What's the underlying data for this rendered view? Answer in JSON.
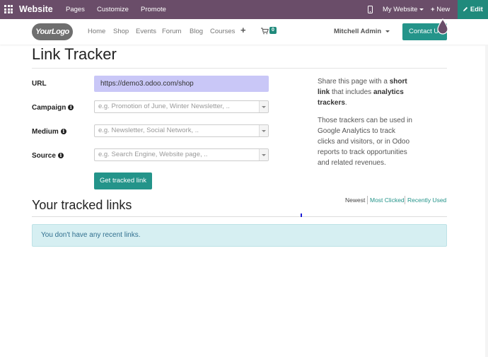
{
  "topbar": {
    "brand": "Website",
    "menu": [
      "Pages",
      "Customize",
      "Promote"
    ],
    "site_selector": "My Website",
    "new_label": "New",
    "edit_label": "Edit"
  },
  "navbar": {
    "logo_text": "YourLogo",
    "links": [
      "Home",
      "Shop",
      "Events",
      "Forum",
      "Blog",
      "Courses"
    ],
    "cart_count": "0",
    "user_name": "Mitchell Admin",
    "contact_label": "Contact Us"
  },
  "page": {
    "title": "Link Tracker",
    "form": {
      "url_label": "URL",
      "url_value": "https://demo3.odoo.com/shop",
      "campaign_label": "Campaign",
      "campaign_placeholder": "e.g. Promotion of June, Winter Newsletter, ..",
      "medium_label": "Medium",
      "medium_placeholder": "e.g. Newsletter, Social Network, ..",
      "source_label": "Source",
      "source_placeholder": "e.g. Search Engine, Website page, ..",
      "submit_label": "Get tracked link"
    },
    "side_text": {
      "p1_a": "Share this page with a ",
      "p1_b": "short link",
      "p1_c": " that includes ",
      "p1_d": "analytics trackers",
      "p1_e": ".",
      "p2": "Those trackers can be used in Google Analytics to track clicks and visitors, or in Odoo reports to track opportunities and related revenues."
    },
    "links_section": {
      "title": "Your tracked links",
      "sort_options": [
        "Newest",
        "Most Clicked",
        "Recently Used"
      ],
      "empty_message": "You don't have any recent links."
    }
  },
  "colors": {
    "topbar": "#6a4d69",
    "accent": "#24948a",
    "url_bg": "#c9c7f7",
    "alert_bg": "#d6eff2"
  }
}
